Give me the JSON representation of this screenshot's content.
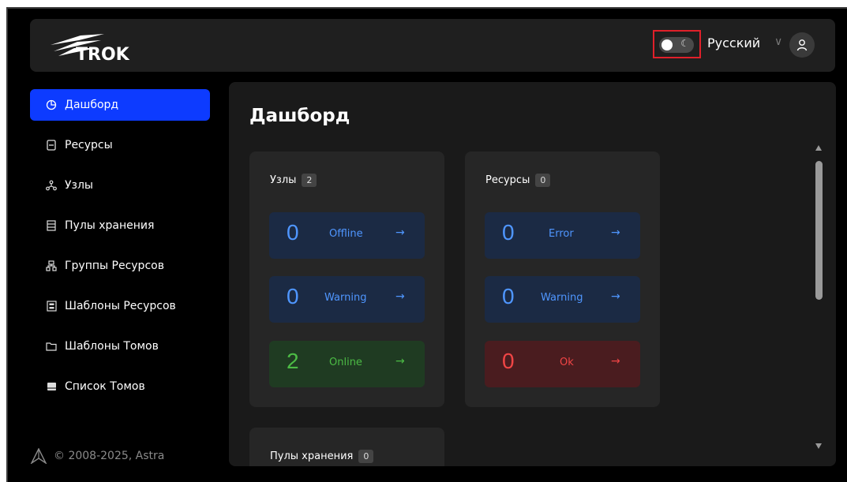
{
  "header": {
    "logo_text": "TROK",
    "language": "Русский"
  },
  "sidebar": {
    "items": [
      {
        "label": "Дашборд",
        "icon": "pie-chart-icon",
        "active": true
      },
      {
        "label": "Ресурсы",
        "icon": "server-icon",
        "active": false
      },
      {
        "label": "Узлы",
        "icon": "nodes-icon",
        "active": false
      },
      {
        "label": "Пулы хранения",
        "icon": "storage-pool-icon",
        "active": false
      },
      {
        "label": "Группы Ресурсов",
        "icon": "group-icon",
        "active": false
      },
      {
        "label": "Шаблоны Ресурсов",
        "icon": "template-icon",
        "active": false
      },
      {
        "label": "Шаблоны Томов",
        "icon": "folder-icon",
        "active": false
      },
      {
        "label": "Список Томов",
        "icon": "volume-list-icon",
        "active": false
      }
    ],
    "copyright": "© 2008-2025, Astra"
  },
  "main": {
    "title": "Дашборд",
    "cards": [
      {
        "title": "Узлы",
        "count": "2",
        "stats": [
          {
            "value": "0",
            "label": "Offline",
            "color": "blue"
          },
          {
            "value": "0",
            "label": "Warning",
            "color": "blue"
          },
          {
            "value": "2",
            "label": "Online",
            "color": "green"
          }
        ]
      },
      {
        "title": "Ресурсы",
        "count": "0",
        "stats": [
          {
            "value": "0",
            "label": "Error",
            "color": "blue"
          },
          {
            "value": "0",
            "label": "Warning",
            "color": "blue"
          },
          {
            "value": "0",
            "label": "Ok",
            "color": "red"
          }
        ]
      }
    ],
    "partial_card": {
      "title": "Пулы хранения",
      "count": "0"
    }
  },
  "colors": {
    "accent": "#0d3bff",
    "stat_blue": "#4f96ff",
    "stat_green": "#4cbb45",
    "stat_red": "#f04545"
  }
}
